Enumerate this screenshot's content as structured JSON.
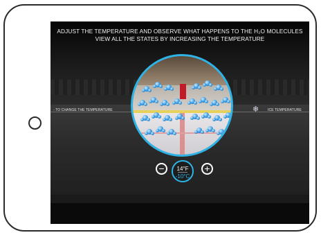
{
  "header": {
    "line1": "ADJUST THE TEMPERATURE AND OBSERVE WHAT HAPPENS TO THE H₂O MOLECULES",
    "line2": "VIEW ALL THE STATES BY INCREASING THE TEMPERATURE"
  },
  "left_hint": "- TO CHANGE THE TEMPERATURE",
  "right_label": "ICE TEMPERATURE",
  "controls": {
    "minus_label": "−",
    "plus_label": "+",
    "temp_f": "14°F",
    "temp_c": "-10°C"
  },
  "icons": {
    "snowflake": "snowflake-icon"
  },
  "colors": {
    "accent": "#2fb3e6",
    "molecule": "#2a8fdc"
  }
}
